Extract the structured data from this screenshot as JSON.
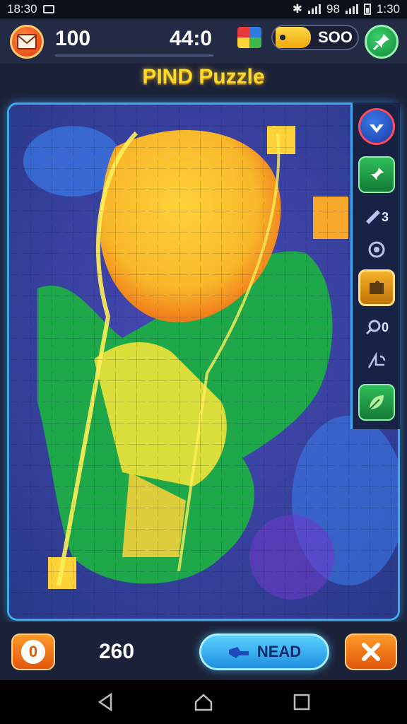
{
  "status_bar": {
    "time_left": "18:30",
    "network_text": "98",
    "time_right": "1:30"
  },
  "header": {
    "score": "100",
    "timer": "44:0",
    "coins": "SOO",
    "title": "PIND Puzzle"
  },
  "side_tools": [
    {
      "icon": "down-arrow-icon"
    },
    {
      "icon": "pin-icon"
    },
    {
      "icon": "wrench-icon",
      "label": "3"
    },
    {
      "icon": "target-icon"
    },
    {
      "icon": "puzzle-piece-icon"
    },
    {
      "icon": "magnifier-icon",
      "label": "0"
    },
    {
      "icon": "shape-icon"
    },
    {
      "icon": "leaf-icon"
    }
  ],
  "footer": {
    "hint_label": "0",
    "pieces_count": "260",
    "next_label": "NEAD",
    "close_symbol": "✕"
  },
  "colors": {
    "accent_blue": "#3fa8f0",
    "puzzle_yellow": "#ffd23a",
    "puzzle_green": "#1fa84a",
    "button_orange": "#f07a1a"
  }
}
